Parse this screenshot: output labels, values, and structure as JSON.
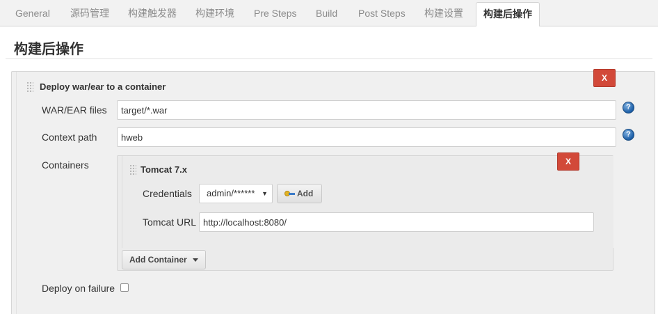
{
  "tabs": [
    {
      "label": "General"
    },
    {
      "label": "源码管理"
    },
    {
      "label": "构建触发器"
    },
    {
      "label": "构建环境"
    },
    {
      "label": "Pre Steps"
    },
    {
      "label": "Build"
    },
    {
      "label": "Post Steps"
    },
    {
      "label": "构建设置"
    },
    {
      "label": "构建后操作"
    }
  ],
  "active_tab": "构建后操作",
  "page_title": "构建后操作",
  "deploy_section": {
    "title": "Deploy war/ear to a container",
    "delete_label": "X",
    "war_files_label": "WAR/EAR files",
    "war_files_value": "target/*.war",
    "context_path_label": "Context path",
    "context_path_value": "hweb",
    "containers_label": "Containers",
    "help_glyph": "?"
  },
  "container": {
    "title": "Tomcat 7.x",
    "delete_label": "X",
    "credentials_label": "Credentials",
    "credentials_value": "admin/******",
    "add_button_label": "Add",
    "tomcat_url_label": "Tomcat URL",
    "tomcat_url_value": "http://localhost:8080/"
  },
  "add_container_label": "Add Container",
  "deploy_on_failure_label": "Deploy on failure",
  "deploy_on_failure_checked": false,
  "colors": {
    "delete_button": "#d24939",
    "help_icon": "#1d5fa8",
    "tab_bar": "#f2f2f2"
  },
  "icons": {
    "help": "question-circle-icon",
    "drag": "drag-handle-icon",
    "key": "key-icon",
    "dropdown": "caret-down-icon"
  }
}
